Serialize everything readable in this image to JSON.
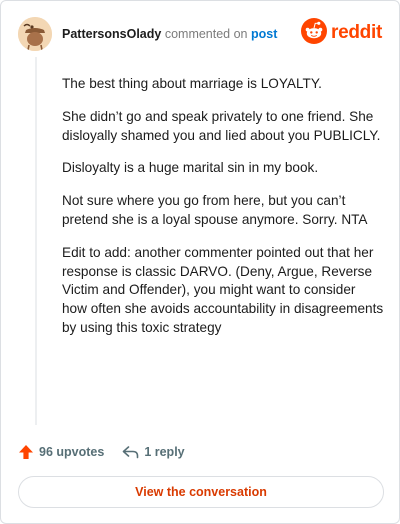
{
  "header": {
    "username": "PattersonsOlady",
    "action_text": "commented on",
    "post_link": "post",
    "logo_text": "reddit"
  },
  "comment": {
    "paragraphs": [
      "The best thing about marriage is LOYALTY.",
      "She didn’t go and speak privately to one friend. She disloyally shamed you and lied about you PUBLICLY.",
      "Disloyalty is a huge marital sin in my book.",
      "Not sure where you go from here, but you can’t pretend she is a loyal spouse anymore. Sorry. NTA",
      "Edit to add: another commenter pointed out that her response is classic DARVO. (Deny, Argue, Reverse Victim and Offender), you might want to consider how often she avoids accountability in disagreements by using this toxic strategy"
    ]
  },
  "actions": {
    "upvotes": "96 upvotes",
    "replies": "1 reply"
  },
  "cta": {
    "label": "View the conversation"
  },
  "colors": {
    "brand": "#ff4500",
    "link": "#0079d3",
    "cta_text": "#d93a00",
    "muted": "#576f76"
  },
  "icons": {
    "avatar": "avatar-icon",
    "logo": "reddit-snoo-icon",
    "upvote": "upvote-arrow-icon",
    "reply": "reply-arrow-icon"
  }
}
